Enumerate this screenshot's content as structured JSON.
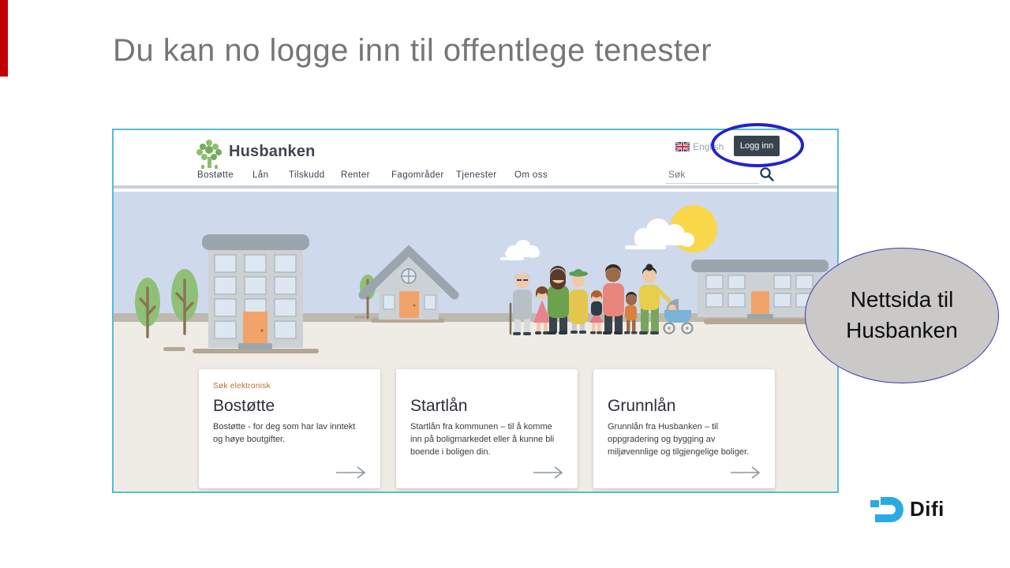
{
  "slide": {
    "title": "Du kan no logge inn til offentlege tenester",
    "callout": {
      "line1": "Nettsida til",
      "line2": "Husbanken"
    },
    "brand": "Difi"
  },
  "website": {
    "logo_text": "Husbanken",
    "nav": [
      "Bostøtte",
      "Lån",
      "Tilskudd",
      "Renter",
      "Fagområder",
      "Tjenester",
      "Om oss"
    ],
    "english_label": "English",
    "login_label": "Logg inn",
    "search_placeholder": "Søk",
    "cards": [
      {
        "tag": "Søk elektronisk",
        "title": "Bostøtte",
        "description": "Bostøtte - for deg som har lav inntekt og høye boutgifter.",
        "arrow": "→"
      },
      {
        "tag": "",
        "title": "Startlån",
        "description": "Startlån fra kommunen – til å komme inn på boligmarkedet eller å kunne bli boende i boligen din.",
        "arrow": "→"
      },
      {
        "tag": "",
        "title": "Grunnlån",
        "description": "Grunnlån fra Husbanken – til oppgradering og bygging av miljøvennlige og tilgjengelige boliger.",
        "arrow": "→"
      }
    ]
  },
  "icons": {
    "logo": "tree-logo-icon",
    "flag": "uk-flag-icon",
    "search": "search-icon",
    "card_arrow": "arrow-right-icon",
    "brand_mark": "difi-mark-icon"
  },
  "colors": {
    "red_bar": "#c00000",
    "title_gray": "#767676",
    "frame_border": "#54bcd5",
    "header_dark": "#39434d",
    "tag_orange": "#c06c2a",
    "annotation_blue": "#2222cc",
    "callout_fill": "#cbc8c8",
    "callout_border": "#3939a8",
    "sky": "#cfd9ec",
    "ground": "#efece6",
    "sun_yellow": "#f8d74b",
    "door_orange": "#f2a369",
    "logo_green": "#8cbe72",
    "difi_blue": "#29abe2"
  }
}
